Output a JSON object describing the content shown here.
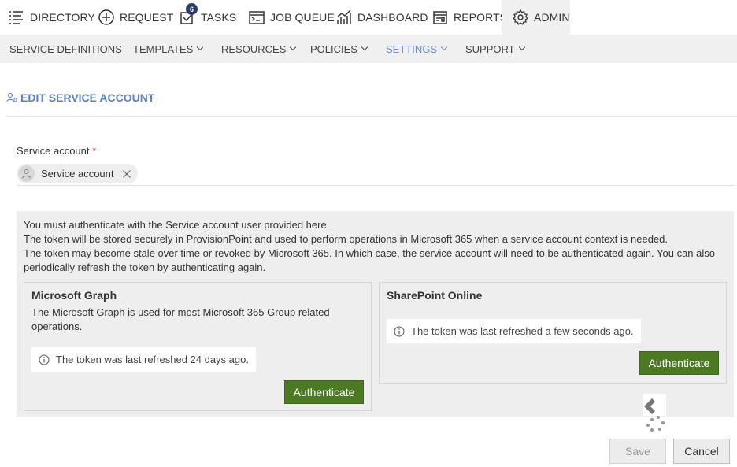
{
  "topnav": {
    "directory": "DIRECTORY",
    "request": "REQUEST",
    "tasks": "TASKS",
    "tasks_badge": "6",
    "job_queue": "JOB QUEUE",
    "dashboard": "DASHBOARD",
    "reports": "REPORTS",
    "admin": "ADMIN"
  },
  "subnav": {
    "service_definitions": "SERVICE DEFINITIONS",
    "templates": "TEMPLATES",
    "resources": "RESOURCES",
    "policies": "POLICIES",
    "settings": "SETTINGS",
    "support": "SUPPORT"
  },
  "page": {
    "title": "EDIT SERVICE ACCOUNT"
  },
  "field": {
    "label": "Service account",
    "required_mark": "*",
    "value": "Service account"
  },
  "info": {
    "line1": "You must authenticate with the Service account user provided here.",
    "line2": "The token will be stored securely in ProvisionPoint and used to perform operations in Microsoft 365 when a service account context is needed.",
    "line3": "The token may become stale over time or revoked by Microsoft 365. In which case, the service account will need to be authenticated again. You can also periodically refresh the token by authenticating again."
  },
  "graph_card": {
    "title": "Microsoft Graph",
    "description": "The Microsoft Graph is used for most Microsoft 365 Group related operations.",
    "token_status": "The token was last refreshed 24 days ago.",
    "button": "Authenticate"
  },
  "sharepoint_card": {
    "title": "SharePoint Online",
    "token_status": "The token was last refreshed a few seconds ago.",
    "button": "Authenticate"
  },
  "actions": {
    "save": "Save",
    "cancel": "Cancel"
  },
  "colors": {
    "accent": "#5b7fbf",
    "active_subnav": "#6c8fc7",
    "auth_button": "#4c7a23",
    "badge": "#2c3b6b"
  }
}
